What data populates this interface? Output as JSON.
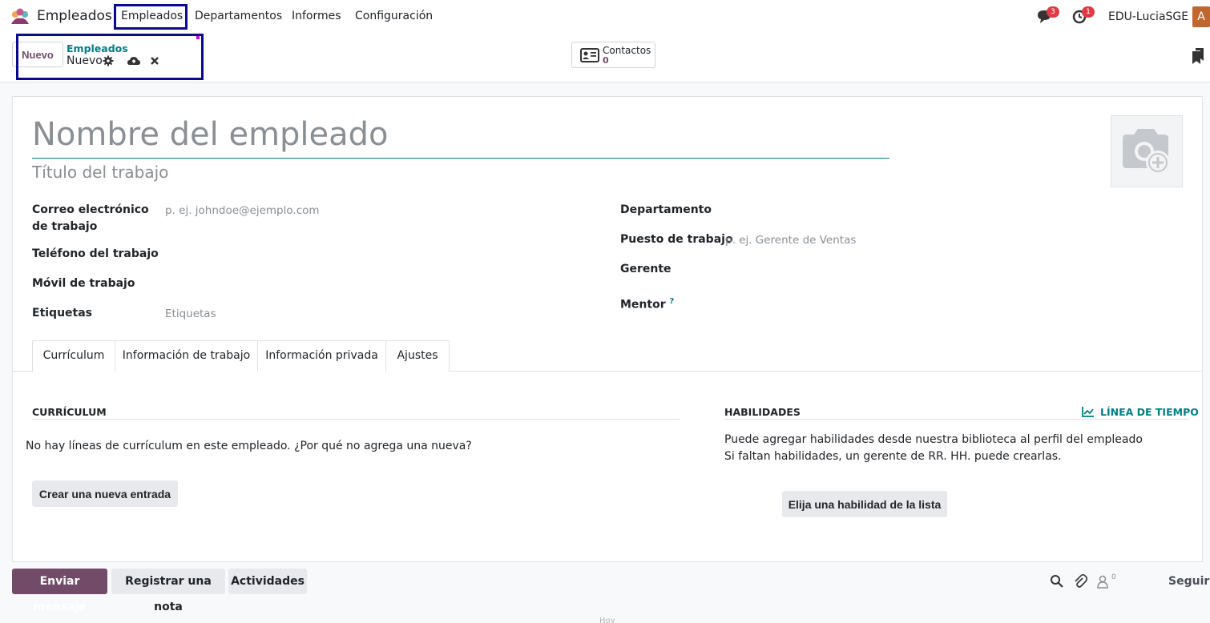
{
  "navbar": {
    "app_name": "Empleados",
    "menu": [
      "Empleados",
      "Departamentos",
      "Informes",
      "Configuración"
    ],
    "messages_badge": "3",
    "activities_badge": "1",
    "company": "EDU-LuciaSGE",
    "avatar_letter": "A"
  },
  "control": {
    "new_button": "Nuevo",
    "breadcrumb_parent": "Empleados",
    "breadcrumb_current": "Nuevo",
    "contacts_label": "Contactos",
    "contacts_count": "0"
  },
  "form": {
    "name_placeholder": "Nombre del empleado",
    "job_title_placeholder": "Título del trabajo",
    "left_fields": {
      "email_label": "Correo electrónico de trabajo",
      "email_placeholder": "p. ej. johndoe@ejemplo.com",
      "phone_label": "Teléfono del trabajo",
      "mobile_label": "Móvil de trabajo",
      "tags_label": "Etiquetas",
      "tags_placeholder": "Etiquetas"
    },
    "right_fields": {
      "department_label": "Departamento",
      "job_position_label": "Puesto de trabajo",
      "job_position_placeholder": "p. ej. Gerente de Ventas",
      "manager_label": "Gerente",
      "mentor_label": "Mentor",
      "mentor_help": "?"
    },
    "tabs": [
      "Currículum",
      "Información de trabajo",
      "Información privada",
      "Ajustes"
    ],
    "resume": {
      "title": "CURRÍCULUM",
      "empty_text": "No hay líneas de currículum en este empleado. ¿Por qué no agrega una nueva?",
      "create_button": "Crear una nueva entrada"
    },
    "skills": {
      "title": "HABILIDADES",
      "timeline_link": "LÍNEA DE TIEMPO",
      "text_line1": "Puede agregar habilidades desde nuestra biblioteca al perfil del empleado",
      "text_line2": "Si faltan habilidades, un gerente de RR. HH. puede crearlas.",
      "pick_button": "Elija una habilidad de la lista"
    }
  },
  "chatter": {
    "send_message": "Enviar mensaje",
    "log_note": "Registrar una nota",
    "activities": "Actividades",
    "followers_count": "0",
    "follow": "Seguir",
    "footer_fragment": "Hoy"
  },
  "colors": {
    "primary": "#714b67",
    "accent": "#017e84",
    "highlight_box": "#0a0a8c",
    "badge": "#e03a46"
  }
}
